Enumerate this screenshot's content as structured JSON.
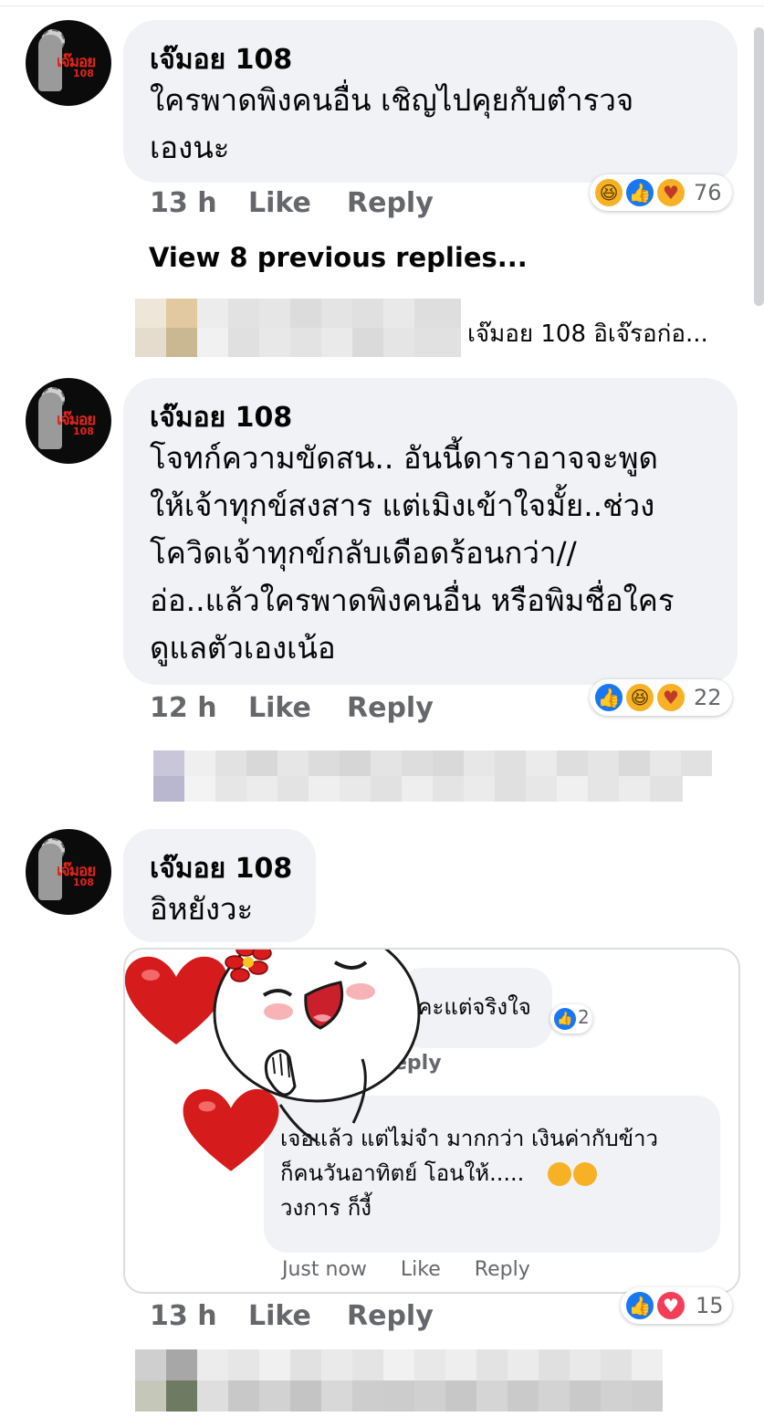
{
  "comments": [
    {
      "author": "เจ๊มอย 108",
      "avatar_text": "เจ๊มอย",
      "avatar_num": "108",
      "lines": [
        "ใครพาดพิงคนอื่น เชิญไปคุยกับตำรวจ",
        "เองนะ"
      ],
      "time": "13 h",
      "like_label": "Like",
      "reply_label": "Reply",
      "reaction_icons": [
        "haha-icon",
        "like-icon",
        "care-icon"
      ],
      "reaction_count": "76"
    },
    {
      "author": "เจ๊มอย 108",
      "avatar_text": "เจ๊มอย",
      "avatar_num": "108",
      "lines": [
        "โจทก์ความขัดสน.. อันนี้ดาราอาจจะพูด",
        "ให้เจ้าทุกข์สงสาร แต่เมิงเข้าใจมั้ย..ช่วง",
        "โควิดเจ้าทุกข์กลับเดือดร้อนกว่า//",
        "อ่อ..แล้วใครพาดพิงคนอื่น หรือพิมชื่อใคร",
        "ดูแลตัวเองเน้อ"
      ],
      "time": "12 h",
      "like_label": "Like",
      "reply_label": "Reply",
      "reaction_icons": [
        "like-icon",
        "haha-icon",
        "care-icon"
      ],
      "reaction_count": "22"
    },
    {
      "author": "เจ๊มอย 108",
      "avatar_text": "เจ๊มอย",
      "avatar_num": "108",
      "lines": [
        "อิหยังวะ"
      ],
      "time": "13 h",
      "like_label": "Like",
      "reply_label": "Reply",
      "reaction_icons": [
        "like-icon",
        "love-icon"
      ],
      "reaction_count": "15"
    }
  ],
  "view_previous": "View 8 previous replies...",
  "reply_preview": "เจ๊มอย 108 อิเจ๊รอก่อ...",
  "sticker_screenshot": {
    "top_text": "นคะแต่จริงใจ",
    "top_reaction_count": "2",
    "top_partial_num": "2",
    "top_reply": "eply",
    "lines": [
      "เจอแล้ว แต่ไม่จำ มากกว่า  เงินค่ากับข้าว",
      "ก็คนวันอาทิตย์ โอนให้.....",
      "วงการ ก็งี้"
    ],
    "time": "Just now",
    "like_label": "Like",
    "reply_label": "Reply"
  },
  "colors": {
    "bubble": "#f0f2f5",
    "meta": "#65676b",
    "like": "#1877f2",
    "love": "#f33e58",
    "haha": "#f7b125"
  }
}
